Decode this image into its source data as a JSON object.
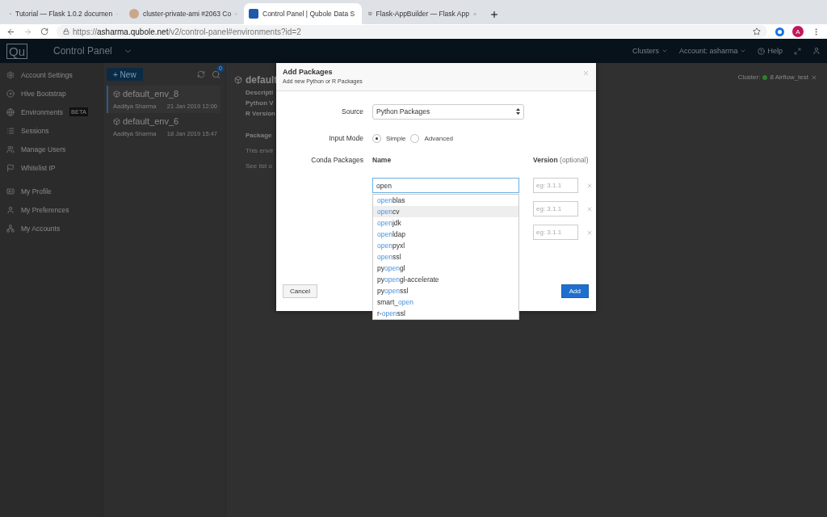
{
  "browser": {
    "tabs": [
      {
        "title": "Tutorial — Flask 1.0.2 documen",
        "selected": false
      },
      {
        "title": "cluster-private-ami #2063 Co",
        "selected": false
      },
      {
        "title": "Control Panel  | Qubole Data S",
        "selected": true
      },
      {
        "title": "Flask-AppBuilder — Flask App",
        "selected": false
      }
    ],
    "url": {
      "scheme": "https://",
      "host": "asharma.qubole.net",
      "path": "/v2/control-panel#environments?id=2"
    },
    "profile_initial": "A"
  },
  "app_header": {
    "logo": "Qu",
    "title": "Control Panel",
    "nav": [
      "Clusters",
      "Account: asharma",
      "Help"
    ]
  },
  "sidebar": {
    "sections": [
      [
        {
          "label": "Account Settings"
        },
        {
          "label": "Hive Bootstrap"
        },
        {
          "label": "Environments",
          "badge": "BETA"
        },
        {
          "label": "Sessions"
        },
        {
          "label": "Manage Users"
        },
        {
          "label": "Whitelist IP"
        }
      ],
      [
        {
          "label": "My Profile"
        },
        {
          "label": "My Preferences"
        },
        {
          "label": "My Accounts"
        }
      ]
    ]
  },
  "environments": {
    "new_button": "+ New",
    "notification_count": "0",
    "items": [
      {
        "name": "default_env_8",
        "author": "Aaditya Sharma",
        "date": "21 Jan 2019 12:00",
        "selected": true
      },
      {
        "name": "default_env_6",
        "author": "Aaditya Sharma",
        "date": "18 Jan 2019 15:47",
        "selected": false
      }
    ]
  },
  "details": {
    "title": "default",
    "fields": [
      "Descripti",
      "Python V",
      "R Version"
    ],
    "section": "Package",
    "notes": [
      "This envir",
      "See list o"
    ]
  },
  "cluster": {
    "label": "Cluster:",
    "name": "8 Airflow_test"
  },
  "modal": {
    "title": "Add Packages",
    "subtitle": "Add new Python or R Packages",
    "source_label": "Source",
    "source_value": "Python Packages",
    "input_mode_label": "Input Mode",
    "modes": [
      {
        "label": "Simple",
        "selected": true
      },
      {
        "label": "Advanced",
        "selected": false
      }
    ],
    "packages_label": "Conda Packages",
    "name_header": "Name",
    "version_header": "Version",
    "version_hint": "(optional)",
    "name_value": "open",
    "rows": [
      {
        "version_placeholder": "eg: 3.1.1"
      },
      {
        "version_placeholder": "eg: 3.1.1"
      },
      {
        "version_placeholder": "eg: 3.1.1"
      }
    ],
    "suggestions": [
      {
        "match": "open",
        "after": "blas",
        "selected": false
      },
      {
        "match": "open",
        "after": "cv",
        "selected": true
      },
      {
        "match": "open",
        "after": "jdk",
        "selected": false
      },
      {
        "match": "open",
        "after": "ldap",
        "selected": false
      },
      {
        "match": "open",
        "after": "pyxl",
        "selected": false
      },
      {
        "match": "open",
        "after": "ssl",
        "selected": false
      },
      {
        "before": "py",
        "match": "open",
        "after": "gl",
        "selected": false
      },
      {
        "before": "py",
        "match": "open",
        "after": "gl-accelerate",
        "selected": false
      },
      {
        "before": "py",
        "match": "open",
        "after": "ssl",
        "selected": false
      },
      {
        "before": "smart_",
        "match": "open",
        "selected": false
      },
      {
        "before": "r-",
        "match": "open",
        "after": "ssl",
        "selected": false
      }
    ],
    "cancel": "Cancel",
    "add": "Add"
  }
}
